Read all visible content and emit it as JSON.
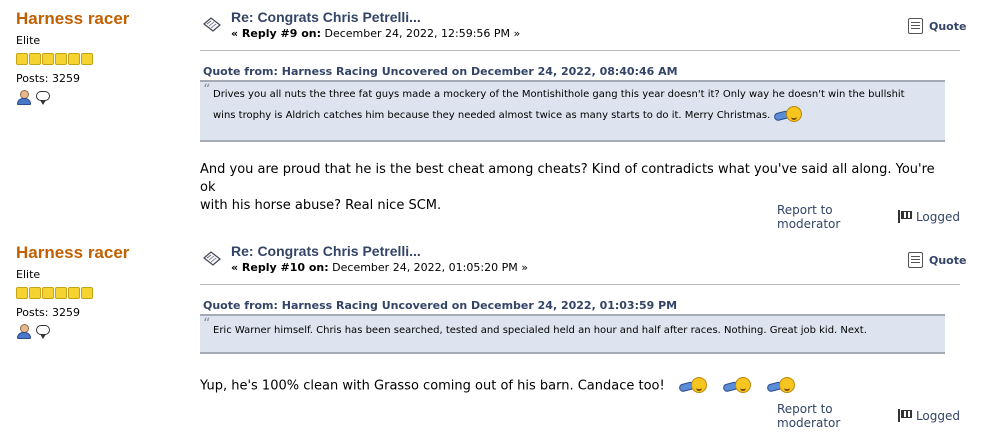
{
  "posts": [
    {
      "poster": {
        "name": "Harness racer",
        "rank": "Elite",
        "stars": 6,
        "posts": "Posts: 3259"
      },
      "subject": "Re: Congrats Chris Petrelli...",
      "reply_label": "« Reply #9 on:",
      "date": "December 24, 2022, 12:59:56 PM »",
      "quote_button": "Quote",
      "quote_header": "Quote from: Harness Racing Uncovered on December 24, 2022, 08:40:46 AM",
      "quote_text_line1": "Drives you all nuts the three fat guys made a mockery of the Montishithole gang this year doesn't it? Only way he doesn't win the bullshit",
      "quote_text_line2": "wins trophy is Aldrich catches him because they needed almost twice as many starts to do it. Merry Christmas.",
      "body_line1": "And you are proud that he is the best cheat among cheats?  Kind of contradicts what you've said all along.  You're ok",
      "body_line2": "with his horse abuse?  Real nice SCM.",
      "report": "Report to moderator",
      "logged": "Logged"
    },
    {
      "poster": {
        "name": "Harness racer",
        "rank": "Elite",
        "stars": 6,
        "posts": "Posts: 3259"
      },
      "subject": "Re: Congrats Chris Petrelli...",
      "reply_label": "« Reply #10 on:",
      "date": "December 24, 2022, 01:05:20 PM »",
      "quote_button": "Quote",
      "quote_header": "Quote from: Harness Racing Uncovered on December 24, 2022, 01:03:59 PM",
      "quote_text_line1": "Eric Warner himself. Chris has been searched, tested and specialed held an hour and half after races. Nothing. Great job kid. Next.",
      "body_line1": "Yup, he's 100% clean with Grasso coming out of his barn.  Candace too!",
      "report": "Report to moderator",
      "logged": "Logged"
    }
  ],
  "icons": {
    "profile": "profile-icon",
    "pm": "personal-message-icon",
    "xx": "message-icon",
    "quote": "quote-icon",
    "ip": "ip-logged-icon",
    "smiley": "thumbs-up-smiley-icon"
  },
  "colors": {
    "poster_name": "#c06002",
    "link": "#334466",
    "quote_bg": "#dde4ef",
    "star": "#f5d431"
  }
}
